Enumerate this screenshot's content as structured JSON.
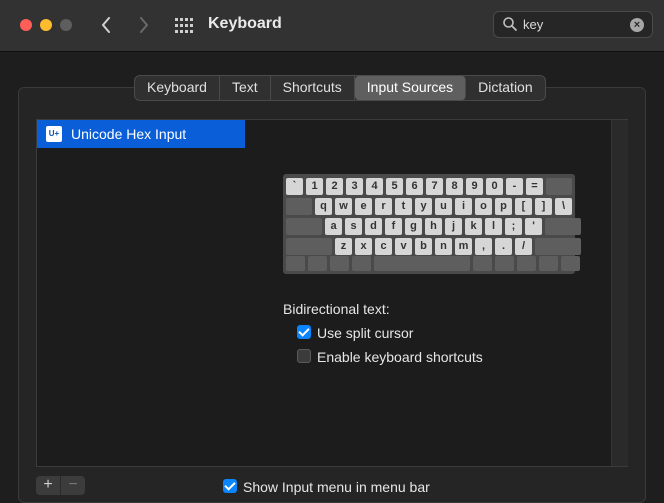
{
  "window": {
    "title": "Keyboard"
  },
  "search": {
    "value": "key",
    "clear_label": "×"
  },
  "tabs": [
    {
      "label": "Keyboard"
    },
    {
      "label": "Text"
    },
    {
      "label": "Shortcuts"
    },
    {
      "label": "Input Sources",
      "active": true
    },
    {
      "label": "Dictation"
    }
  ],
  "input_sources": [
    {
      "icon": "U+",
      "label": "Unicode Hex Input",
      "selected": true
    }
  ],
  "keyboard_rows": [
    [
      "`",
      "1",
      "2",
      "3",
      "4",
      "5",
      "6",
      "7",
      "8",
      "9",
      "0",
      "-",
      "="
    ],
    [
      "q",
      "w",
      "e",
      "r",
      "t",
      "y",
      "u",
      "i",
      "o",
      "p",
      "[",
      "]",
      "\\"
    ],
    [
      "a",
      "s",
      "d",
      "f",
      "g",
      "h",
      "j",
      "k",
      "l",
      ";",
      "'"
    ],
    [
      "z",
      "x",
      "c",
      "v",
      "b",
      "n",
      "m",
      ",",
      ".",
      "/"
    ]
  ],
  "bidi": {
    "title": "Bidirectional text:",
    "split_cursor_label": "Use split cursor",
    "split_cursor_checked": true,
    "shortcuts_label": "Enable keyboard shortcuts",
    "shortcuts_checked": false
  },
  "list_controls": {
    "add": "+",
    "remove": "−"
  },
  "show_menu": {
    "label": "Show Input menu in menu bar",
    "checked": true
  }
}
